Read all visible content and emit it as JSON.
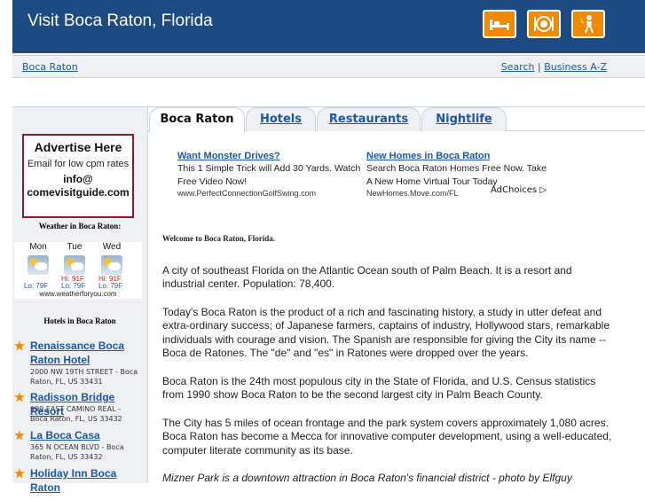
{
  "header": {
    "title": "Visit Boca Raton, Florida",
    "icons": [
      "hotel-bed-icon",
      "restaurant-plate-icon",
      "nightlife-icon"
    ],
    "color": "#1e4a82",
    "icon_color": "#f28a00"
  },
  "subbar": {
    "breadcrumb": "Boca Raton",
    "search": "Search",
    "separator": "|",
    "business": "Business A-Z"
  },
  "tabs": [
    {
      "label": "Boca Raton",
      "active": true
    },
    {
      "label": "Hotels",
      "active": false
    },
    {
      "label": "Restaurants",
      "active": false
    },
    {
      "label": "Nightlife",
      "active": false
    }
  ],
  "sidebar": {
    "ad": {
      "heading": "Advertise Here",
      "sub": "Email for low cpm rates",
      "info1": "info@",
      "info2": "comevisitguide.com"
    },
    "weather_title": "Weather in Boca Raton:",
    "weather": [
      {
        "day": "Mon",
        "hi": "",
        "lo": "Lo: 79F"
      },
      {
        "day": "Tue",
        "hi": "Hi: 91F",
        "lo": "Lo: 79F"
      },
      {
        "day": "Wed",
        "hi": "Hi: 91F",
        "lo": "Lo: 79F"
      }
    ],
    "weather_footer": "www.weatherforyou.com",
    "hotels_title": "Hotels in Boca Raton",
    "hotels": [
      {
        "name1": "Renaissance Boca",
        "name2": "Raton Hotel",
        "addr1": "2000 NW 19TH STREET - Boca",
        "addr2": "Raton, FL, US 33431"
      },
      {
        "name1": "Radisson Bridge Resort",
        "name2": "",
        "addr1": "999 EAST CAMINO REAL -",
        "addr2": "Boca Raton, FL, US 33432"
      },
      {
        "name1": "La Boca Casa",
        "name2": "",
        "addr1": "365 N OCEAN BLVD - Boca",
        "addr2": "Raton, FL, US 33432"
      },
      {
        "name1": "Holiday Inn Boca Raton",
        "name2": "",
        "addr1": "",
        "addr2": ""
      }
    ]
  },
  "ads": [
    {
      "title": "Want Monster Drives?",
      "desc": "This 1 Simple Trick will Add 30 Yards. Watch Free Video Now!",
      "url": "www.PerfectConnectionGolfSwing.com"
    },
    {
      "title": "New Homes in Boca Raton",
      "desc": "Search Boca Raton Homes Free Now. Take A New Home Virtual Tour Today",
      "url": "NewHomes.Move.com/FL"
    }
  ],
  "adchoices": "AdChoices",
  "article": {
    "welcome": "Welcome to Boca Raton, Florida.",
    "p1": "A city of southeast Florida on the Atlantic Ocean south of Palm Beach. It is a resort and industrial center. Population: 78,400.",
    "p2": "Today's Boca Raton is the product of a rich and fascinating history, a study in utter defeat and extra-ordinary success; of Japanese farmers, captains of industry, Hollywood stars, remarkable individuals with courage and vision. The Spanish are responsible for giving the City its name -- Boca de Ratones. The \"de\" and \"es\" in Ratones were dropped over the years.",
    "p3": "Boca Raton is the 24th most populous city in the State of Florida, and U.S. Census statistics from 1990 show Boca Raton to be the second largest city in Palm Beach County.",
    "p4": "The City has 5 miles of ocean frontage and the park system covers approximately 1,080 acres. Boca Raton has become a Mecca for innovative computer development, using a well-educated, computer literate community as its base.",
    "caption": "Mizner Park is a downtown attraction in Boca Raton's financial district - photo by Elfguy"
  }
}
